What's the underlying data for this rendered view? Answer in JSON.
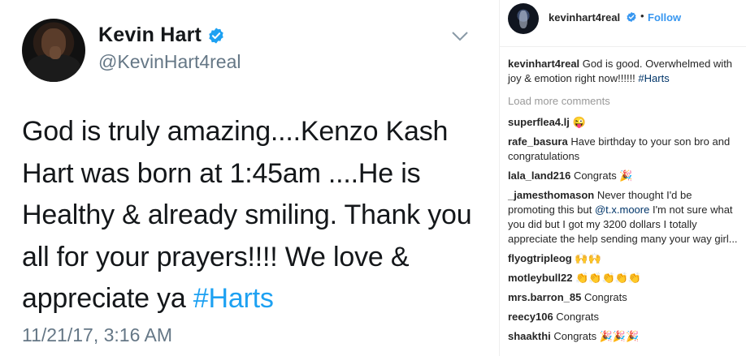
{
  "tweet": {
    "display_name": "Kevin Hart",
    "handle": "@KevinHart4real",
    "text_line1": "God is truly amazing....Kenzo Kash",
    "text_line2": "Hart was born at 1:45am ....He is",
    "text_line3": "Healthy & already smiling. Thank you",
    "text_line4": "all for your prayers!!!! We love &",
    "text_line5_prefix": "appreciate ya ",
    "hashtag": "#Harts",
    "timestamp": "11/21/17, 3:16 AM",
    "hashtag_color": "#1da1f2",
    "icons": {
      "verified": "verified-badge-icon",
      "caret": "chevron-down-icon"
    }
  },
  "instagram": {
    "username": "kevinhart4real",
    "dot": "•",
    "follow_label": "Follow",
    "accent_color": "#3897f0",
    "caption": {
      "user": "kevinhart4real",
      "text": " God is good. Overwhelmed with joy & emotion right now!!!!!! ",
      "tag": "#Harts"
    },
    "load_more": "Load more comments",
    "comments": [
      {
        "user": "superflea4.lj",
        "text": " 😜"
      },
      {
        "user": "rafe_basura",
        "text": " Have birthday to your son bro and congratulations"
      },
      {
        "user": "lala_land216",
        "text": " Congrats 🎉"
      },
      {
        "user": "_jamesthomason",
        "text_pre": " Never thought I'd be promoting this but ",
        "mention": "@t.x.moore",
        "text_post": " I'm not sure what you did but I got my 3200 dollars I totally appreciate the help sending many your way girl..."
      },
      {
        "user": "flyogtripleog",
        "text": " 🙌🙌"
      },
      {
        "user": "motleybull22",
        "text": " 👏👏👏👏👏"
      },
      {
        "user": "mrs.barron_85",
        "text": " Congrats"
      },
      {
        "user": "reecy106",
        "text": " Congrats"
      },
      {
        "user": "shaakthi",
        "text": " Congrats 🎉🎉🎉"
      }
    ]
  }
}
